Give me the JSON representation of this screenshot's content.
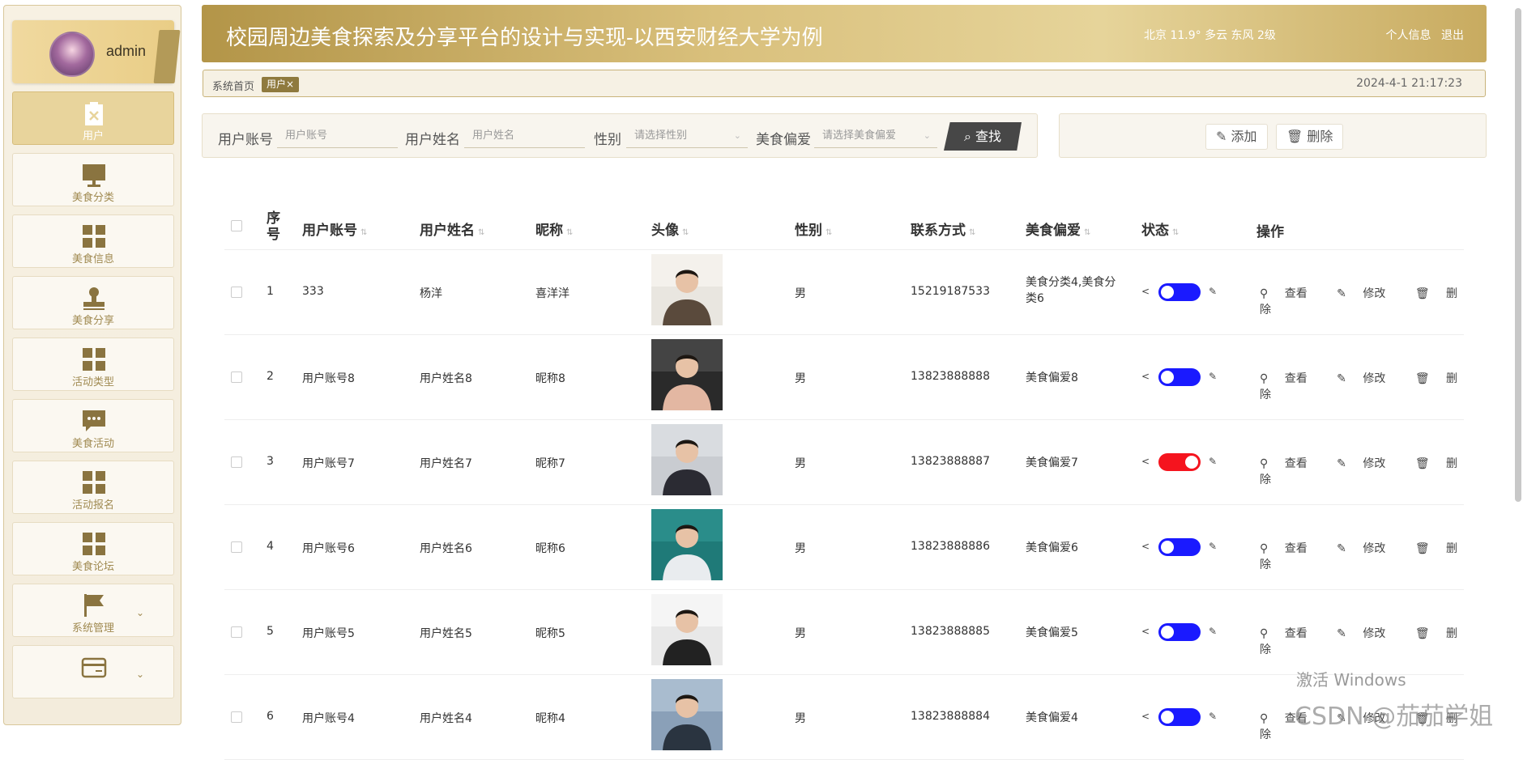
{
  "sidebar": {
    "profile_name": "admin",
    "items": [
      {
        "label": "用户",
        "icon": "clipboard-icon"
      },
      {
        "label": "美食分类",
        "icon": "monitor-icon"
      },
      {
        "label": "美食信息",
        "icon": "grid-icon"
      },
      {
        "label": "美食分享",
        "icon": "stamp-icon"
      },
      {
        "label": "活动类型",
        "icon": "grid-icon"
      },
      {
        "label": "美食活动",
        "icon": "chat-icon"
      },
      {
        "label": "活动报名",
        "icon": "grid-icon"
      },
      {
        "label": "美食论坛",
        "icon": "grid-icon"
      },
      {
        "label": "系统管理",
        "icon": "flag-icon"
      },
      {
        "label": "",
        "icon": "card-icon"
      }
    ]
  },
  "header": {
    "title": "校园周边美食探索及分享平台的设计与实现-以西安财经大学为例",
    "weather": "北京  11.9°  多云  东风  2级",
    "profile_link": "个人信息",
    "logout_link": "退出"
  },
  "breadcrumb": {
    "home": "系统首页",
    "tag": "用户×",
    "datetime": "2024-4-1 21:17:23"
  },
  "search": {
    "account_label": "用户账号",
    "account_placeholder": "用户账号",
    "name_label": "用户姓名",
    "name_placeholder": "用户姓名",
    "gender_label": "性别",
    "gender_placeholder": "请选择性别",
    "pref_label": "美食偏爱",
    "pref_placeholder": "请选择美食偏爱",
    "search_button": "查找"
  },
  "actions": {
    "add": "添加",
    "delete": "删除"
  },
  "table": {
    "headers": {
      "index": "序号",
      "account": "用户账号",
      "name": "用户姓名",
      "nickname": "昵称",
      "avatar": "头像",
      "gender": "性别",
      "phone": "联系方式",
      "pref": "美食偏爱",
      "status": "状态",
      "ops": "操作"
    },
    "op_view": "查看",
    "op_edit": "修改",
    "op_delete": "删除",
    "rows": [
      {
        "index": "1",
        "account": "333",
        "name": "杨洋",
        "nickname": "喜洋洋",
        "gender": "男",
        "phone": "15219187533",
        "pref": "美食分类4,美食分类6",
        "status_on": false
      },
      {
        "index": "2",
        "account": "用户账号8",
        "name": "用户姓名8",
        "nickname": "昵称8",
        "gender": "男",
        "phone": "13823888888",
        "pref": "美食偏爱8",
        "status_on": false
      },
      {
        "index": "3",
        "account": "用户账号7",
        "name": "用户姓名7",
        "nickname": "昵称7",
        "gender": "男",
        "phone": "13823888887",
        "pref": "美食偏爱7",
        "status_on": true
      },
      {
        "index": "4",
        "account": "用户账号6",
        "name": "用户姓名6",
        "nickname": "昵称6",
        "gender": "男",
        "phone": "13823888886",
        "pref": "美食偏爱6",
        "status_on": false
      },
      {
        "index": "5",
        "account": "用户账号5",
        "name": "用户姓名5",
        "nickname": "昵称5",
        "gender": "男",
        "phone": "13823888885",
        "pref": "美食偏爱5",
        "status_on": false
      },
      {
        "index": "6",
        "account": "用户账号4",
        "name": "用户姓名4",
        "nickname": "昵称4",
        "gender": "男",
        "phone": "13823888884",
        "pref": "美食偏爱4",
        "status_on": false
      }
    ]
  },
  "colors": {
    "accent_gold": "#c8ab60",
    "toggle_off": "#1a1aff",
    "toggle_on": "#f5141e"
  },
  "watermark": {
    "activate": "激活 Windows",
    "csdn": "CSDN @茄茄学姐"
  }
}
